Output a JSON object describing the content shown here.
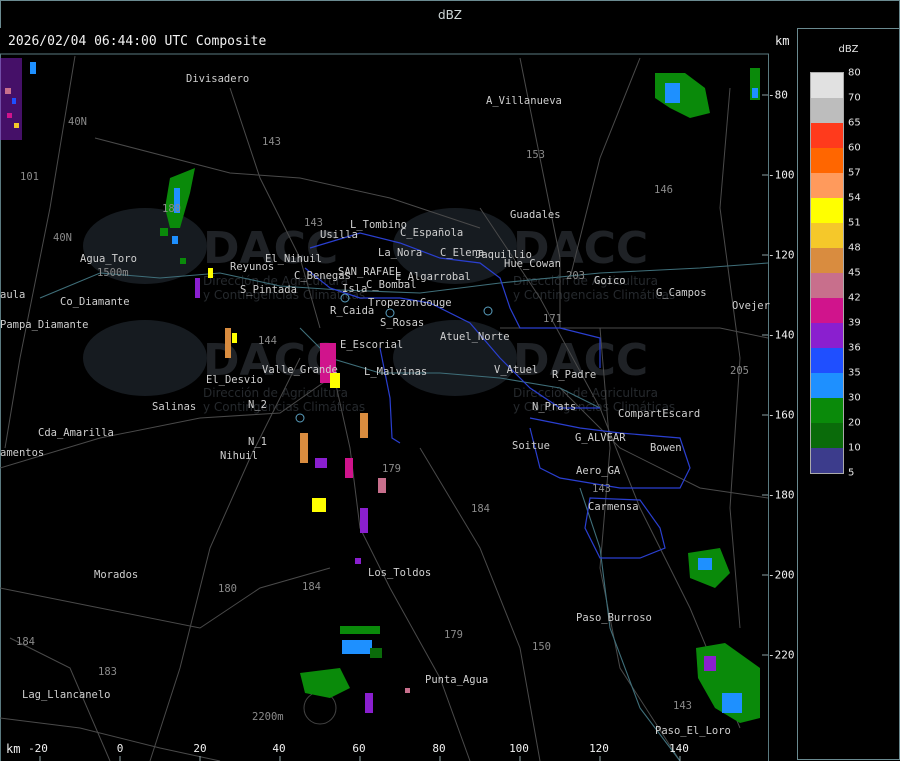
{
  "header": {
    "title": "dBZ"
  },
  "map": {
    "timestamp": "2026/02/04 06:44:00 UTC Composite",
    "unit_top": "km",
    "unit_bottom": "km",
    "x_ticks": [
      "-20",
      "0",
      "20",
      "40",
      "60",
      "80",
      "100",
      "120",
      "140"
    ],
    "y_ticks": [
      "-80",
      "-100",
      "-120",
      "-140",
      "-160",
      "-180",
      "-200",
      "-220"
    ],
    "watermark": {
      "brand": "DACC",
      "line1": "Dirección de Agricultura",
      "line2": "y Contingencias Climáticas"
    },
    "places": [
      "Divisadero",
      "A_Villanueva",
      "40N",
      "101",
      "Agua_Toro",
      "1500m",
      "aula",
      "Pampa_Diamante",
      "Co_Diamante",
      "L_Tombino",
      "Usilla",
      "C_Española",
      "La_Nora",
      "C_Elena",
      "Jaquillio",
      "Hue_Cowan",
      "Reyunos",
      "El_Nihuil",
      "C_Benegas",
      "SAN_RAFAEL",
      "E_Algarrobal",
      "C_Bombal",
      "S_Pintada",
      "Isla",
      "Tropezon",
      "Gouge",
      "Guadales",
      "Goico",
      "G_Campos",
      "Ovejer",
      "R_Caida",
      "S_Rosas",
      "Atuel_Norte",
      "E_Escorial",
      "El_Desvio",
      "Valle_Grande",
      "L_Malvinas",
      "V_Atuel",
      "R_Padre",
      "Salinas",
      "N_Prats",
      "CompartEscard",
      "Cda_Amarilla",
      "G_ALVEAR",
      "Bowen",
      "amentos",
      "Nihuil",
      "N_1",
      "N_2",
      "Soitue",
      "Aero_GA",
      "Carmensa",
      "Morados",
      "Los_Toldos",
      "Paso_Burroso",
      "Punta_Agua",
      "Lag_Llancanelo",
      "2200m",
      "Paso_El_Loro"
    ],
    "routes": [
      "143",
      "153",
      "146",
      "40N",
      "143",
      "203",
      "171",
      "144",
      "179",
      "184",
      "180",
      "184",
      "183",
      "184",
      "179",
      "150",
      "143",
      "143",
      "205",
      "180"
    ]
  },
  "legend": {
    "title": "dBZ",
    "levels": [
      {
        "label": "80",
        "color": "#e1e1e1"
      },
      {
        "label": "70",
        "color": "#bdbdbd"
      },
      {
        "label": "65",
        "color": "#ff3a1c"
      },
      {
        "label": "60",
        "color": "#ff6600"
      },
      {
        "label": "57",
        "color": "#ff9a5c"
      },
      {
        "label": "54",
        "color": "#ffff00"
      },
      {
        "label": "51",
        "color": "#f5c82a"
      },
      {
        "label": "48",
        "color": "#d98c3f"
      },
      {
        "label": "45",
        "color": "#c86f8c"
      },
      {
        "label": "42",
        "color": "#d0148c"
      },
      {
        "label": "39",
        "color": "#8a1fcf"
      },
      {
        "label": "36",
        "color": "#1f4fff"
      },
      {
        "label": "35",
        "color": "#1e90ff"
      },
      {
        "label": "30",
        "color": "#0a8a0a"
      },
      {
        "label": "20",
        "color": "#0a6b0a"
      },
      {
        "label": "10",
        "color": "#3c3c8c"
      },
      {
        "label": "5",
        "color": "#3c3c8c"
      }
    ]
  }
}
